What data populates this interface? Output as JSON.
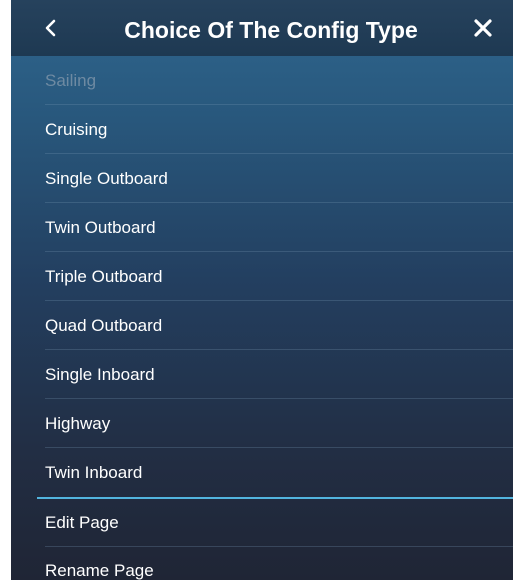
{
  "header": {
    "title": "Choice Of The Config Type",
    "back_icon": "chevron-left-icon",
    "close_icon": "close-icon"
  },
  "config_types": [
    {
      "label": "Sailing",
      "enabled": false
    },
    {
      "label": "Cruising",
      "enabled": true
    },
    {
      "label": "Single Outboard",
      "enabled": true
    },
    {
      "label": "Twin Outboard",
      "enabled": true
    },
    {
      "label": "Triple Outboard",
      "enabled": true
    },
    {
      "label": "Quad Outboard",
      "enabled": true
    },
    {
      "label": "Single Inboard",
      "enabled": true
    },
    {
      "label": "Highway",
      "enabled": true
    },
    {
      "label": "Twin Inboard",
      "enabled": true
    }
  ],
  "page_actions": [
    {
      "label": "Edit Page"
    },
    {
      "label": "Rename Page"
    }
  ],
  "colors": {
    "accent_divider": "#52b4de",
    "disabled_text": "#6e8aa2"
  }
}
